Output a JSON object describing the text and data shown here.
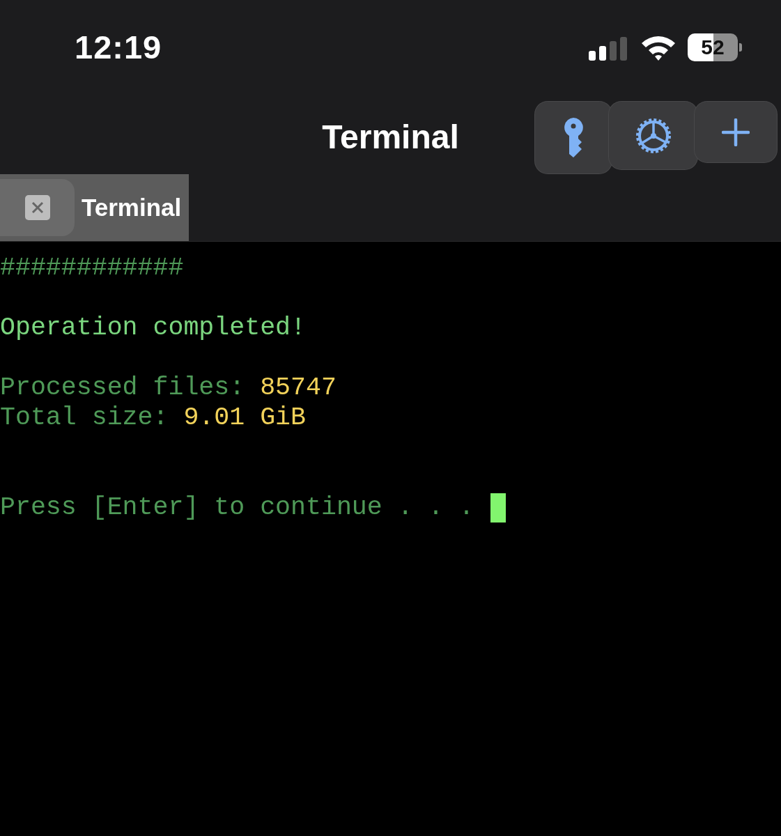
{
  "status_bar": {
    "time": "12:19",
    "battery": "52"
  },
  "nav": {
    "title": "Terminal",
    "buttons": [
      {
        "kind": "key"
      },
      {
        "kind": "gear"
      },
      {
        "kind": "plus"
      }
    ]
  },
  "tabs": [
    {
      "label": "Terminal",
      "selected": true
    }
  ],
  "terminal": {
    "lines": [
      {
        "kind": "text",
        "segments": [
          {
            "kind": "dim",
            "text": "############"
          }
        ]
      },
      {
        "kind": "blank"
      },
      {
        "kind": "text",
        "segments": [
          {
            "kind": "bright",
            "text": "Operation completed!"
          }
        ]
      },
      {
        "kind": "blank"
      },
      {
        "kind": "text",
        "segments": [
          {
            "kind": "dim",
            "text": "Processed files: "
          },
          {
            "kind": "value",
            "text": "85747"
          }
        ]
      },
      {
        "kind": "text",
        "segments": [
          {
            "kind": "dim",
            "text": "Total size: "
          },
          {
            "kind": "value",
            "text": "9.01 GiB"
          }
        ]
      },
      {
        "kind": "blank"
      },
      {
        "kind": "blank"
      },
      {
        "kind": "text",
        "cursor": true,
        "segments": [
          {
            "kind": "dim",
            "text": "Press [Enter] to continue . . . "
          }
        ]
      }
    ]
  }
}
